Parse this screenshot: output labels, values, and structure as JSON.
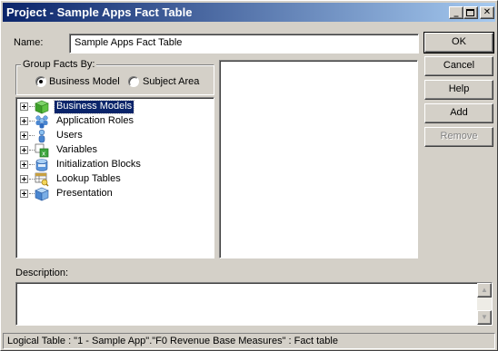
{
  "window": {
    "title": "Project - Sample Apps Fact Table",
    "minimize_glyph": "_",
    "maximize_glyph": "□",
    "close_glyph": "✕"
  },
  "form": {
    "name_label": "Name:",
    "name_value": "Sample Apps Fact Table",
    "group_label": "Group Facts By:",
    "radio_business_model": "Business Model",
    "radio_subject_area": "Subject Area",
    "selected_group": "Business Model",
    "description_label": "Description:",
    "description_value": ""
  },
  "buttons": {
    "ok": "OK",
    "cancel": "Cancel",
    "help": "Help",
    "add": "Add",
    "remove": "Remove"
  },
  "tree": {
    "items": [
      {
        "label": "Business Models",
        "icon": "cube-green-icon",
        "selected": true
      },
      {
        "label": "Application Roles",
        "icon": "people-group-icon",
        "selected": false
      },
      {
        "label": "Users",
        "icon": "user-icon",
        "selected": false
      },
      {
        "label": "Variables",
        "icon": "variable-icon",
        "selected": false
      },
      {
        "label": "Initialization Blocks",
        "icon": "database-icon",
        "selected": false
      },
      {
        "label": "Lookup Tables",
        "icon": "lookup-table-icon",
        "selected": false
      },
      {
        "label": "Presentation",
        "icon": "presentation-cube-icon",
        "selected": false
      }
    ]
  },
  "status": {
    "text": "Logical Table : \"1 - Sample App\".\"F0 Revenue Base Measures\" : Fact table"
  },
  "colors": {
    "title_gradient_start": "#0a246a",
    "title_gradient_end": "#a6caf0",
    "face": "#d4d0c8",
    "selection": "#0a246a"
  }
}
